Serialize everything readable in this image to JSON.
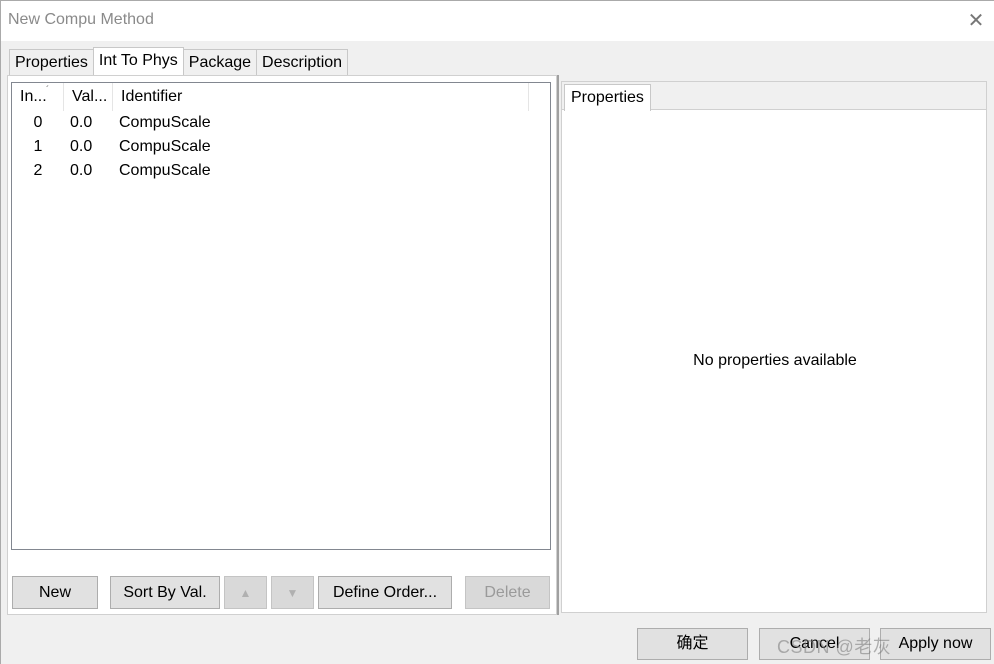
{
  "window": {
    "title": "New Compu Method",
    "close_icon": "close-icon"
  },
  "tabs": [
    {
      "label": "Properties",
      "active": false
    },
    {
      "label": "Int To Phys",
      "active": true
    },
    {
      "label": "Package",
      "active": false
    },
    {
      "label": "Description",
      "active": false
    }
  ],
  "list": {
    "columns": [
      "In...",
      "Val...",
      "Identifier"
    ],
    "sort_indicator": "´",
    "rows": [
      {
        "index": "0",
        "value": "0.0",
        "identifier": "CompuScale"
      },
      {
        "index": "1",
        "value": "0.0",
        "identifier": "CompuScale"
      },
      {
        "index": "2",
        "value": "0.0",
        "identifier": "CompuScale"
      }
    ]
  },
  "toolbar": {
    "new_label": "New",
    "sort_label": "Sort By Val.",
    "up_icon": "▲",
    "down_icon": "▼",
    "define_order_label": "Define Order...",
    "delete_label": "Delete"
  },
  "properties_pane": {
    "tab_label": "Properties",
    "empty_message": "No properties available"
  },
  "dialog_buttons": {
    "ok_label": "确定",
    "cancel_label": "Cancel",
    "apply_label": "Apply now"
  },
  "watermark": "CSDN @老灰"
}
